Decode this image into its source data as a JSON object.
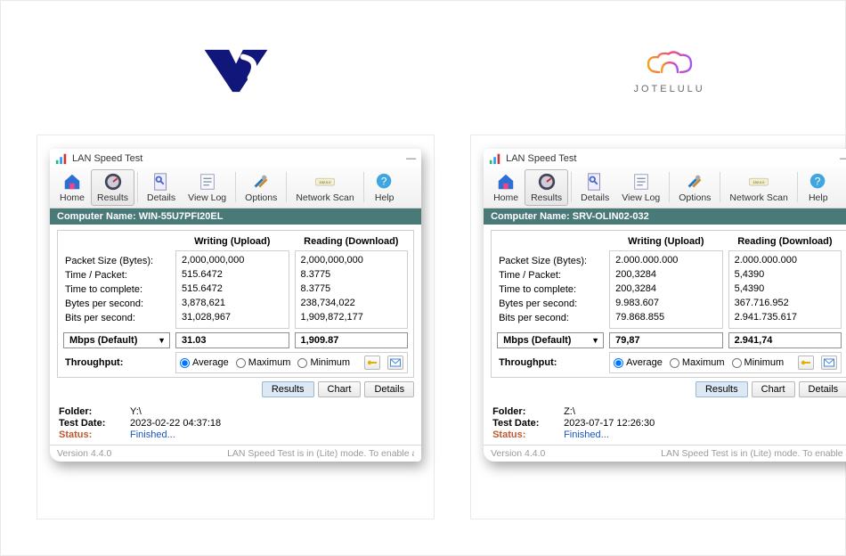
{
  "app_title": "LAN Speed Test",
  "toolbar": {
    "home": "Home",
    "results": "Results",
    "details": "Details",
    "viewlog": "View Log",
    "options": "Options",
    "netscan": "Network Scan",
    "help": "Help"
  },
  "grid_labels": {
    "writing": "Writing (Upload)",
    "reading": "Reading (Download)",
    "packet": "Packet Size (Bytes):",
    "timepkt": "Time / Packet:",
    "timecomp": "Time to complete:",
    "bytesps": "Bytes per second:",
    "bitsps": "Bits per second:",
    "unit": "Mbps (Default)",
    "throughput": "Throughput:",
    "avg": "Average",
    "max": "Maximum",
    "min": "Minimum"
  },
  "tabs": {
    "results": "Results",
    "chart": "Chart",
    "details": "Details"
  },
  "meta_labels": {
    "folder": "Folder:",
    "testdate": "Test Date:",
    "status": "Status:",
    "finished": "Finished..."
  },
  "footer": {
    "version": "Version 4.4.0",
    "lite": "LAN Speed Test is in (Lite) mode.  To enable all fe"
  },
  "left": {
    "computer_name_label": "Computer Name:",
    "computer_name": "WIN-55U7PFI20EL",
    "writing": {
      "packet": "2,000,000,000",
      "timepkt": "515.6472",
      "timecomp": "515.6472",
      "bytesps": "3,878,621",
      "bitsps": "31,028,967"
    },
    "reading": {
      "packet": "2,000,000,000",
      "timepkt": "8.3775",
      "timecomp": "8.3775",
      "bytesps": "238,734,022",
      "bitsps": "1,909,872,177"
    },
    "mbps_w": "31.03",
    "mbps_r": "1,909.87",
    "folder": "Y:\\",
    "testdate": "2023-02-22 04:37:18"
  },
  "right": {
    "computer_name_label": "Computer Name:",
    "computer_name": "SRV-OLIN02-032",
    "writing": {
      "packet": "2.000.000.000",
      "timepkt": "200,3284",
      "timecomp": "200,3284",
      "bytesps": "9.983.607",
      "bitsps": "79.868.855"
    },
    "reading": {
      "packet": "2.000.000.000",
      "timepkt": "5,4390",
      "timecomp": "5,4390",
      "bytesps": "367.716.952",
      "bitsps": "2.941.735.617"
    },
    "mbps_w": "79,87",
    "mbps_r": "2.941,74",
    "folder": "Z:\\",
    "testdate": "2023-07-17 12:26:30"
  },
  "logo_j_text": "JOTELULU"
}
